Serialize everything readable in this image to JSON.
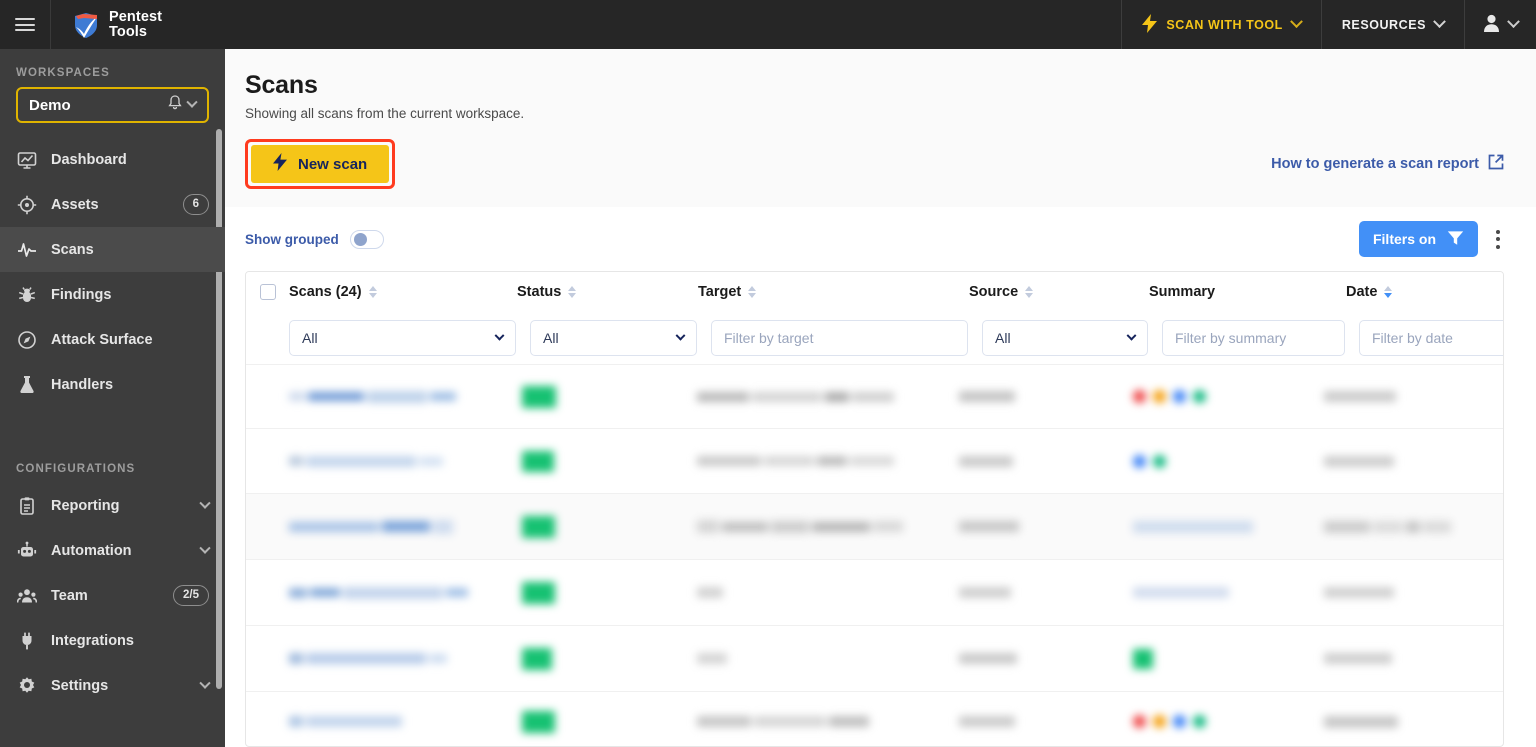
{
  "topbar": {
    "menu_icon": "hamburger-menu-icon",
    "logo": {
      "line1": "Pentest",
      "line2": "Tools",
      "icon": "shield-logo-icon"
    },
    "nav": [
      {
        "label": "SCAN WITH TOOL",
        "icon": "lightning-bolt-icon",
        "chevron": "chevron-down-icon",
        "color": "#F5C518"
      },
      {
        "label": "RESOURCES",
        "chevron": "chevron-down-icon",
        "color": "#f2f2f2"
      }
    ],
    "account": {
      "icon": "user-avatar-icon",
      "chevron": "chevron-down-icon"
    }
  },
  "sidebar": {
    "workspaces_label": "WORKSPACES",
    "workspace": {
      "name": "Demo",
      "bell_icon": "bell-icon",
      "chevron": "chevron-down-icon",
      "border_color": "#E0B400"
    },
    "items": [
      {
        "label": "Dashboard",
        "icon": "dashboard-icon",
        "active": false
      },
      {
        "label": "Assets",
        "icon": "target-icon",
        "badge": "6",
        "active": false
      },
      {
        "label": "Scans",
        "icon": "pulse-icon",
        "active": true
      },
      {
        "label": "Findings",
        "icon": "bug-icon",
        "active": false
      },
      {
        "label": "Attack Surface",
        "icon": "compass-icon",
        "active": false
      },
      {
        "label": "Handlers",
        "icon": "flask-icon",
        "active": false
      }
    ],
    "configurations_label": "CONFIGURATIONS",
    "config_items": [
      {
        "label": "Reporting",
        "icon": "clipboard-icon",
        "chevron": "chevron-down-icon"
      },
      {
        "label": "Automation",
        "icon": "robot-icon",
        "chevron": "chevron-down-icon"
      },
      {
        "label": "Team",
        "icon": "people-icon",
        "badge": "2/5"
      },
      {
        "label": "Integrations",
        "icon": "plug-icon"
      },
      {
        "label": "Settings",
        "icon": "gear-icon",
        "chevron": "chevron-down-icon"
      }
    ]
  },
  "main": {
    "title": "Scans",
    "subtitle": "Showing all scans from the current workspace.",
    "new_scan_button": {
      "label": "New scan",
      "icon": "lightning-bolt-icon",
      "bg": "#F5C518",
      "text_color": "#16245C",
      "highlight_color": "#FF3B1F"
    },
    "report_link": {
      "label": "How to generate a scan report",
      "icon": "external-link-icon",
      "color": "#3C5BA9"
    },
    "toolbar": {
      "show_grouped_label": "Show grouped",
      "show_grouped_on": false,
      "filters_button": {
        "label": "Filters on",
        "icon": "funnel-icon",
        "bg": "#4290F7"
      },
      "overflow_menu_icon": "kebab-menu-icon"
    },
    "table": {
      "columns": [
        {
          "key": "scans",
          "header": "Scans (24)",
          "sortable": true,
          "sort_active": false,
          "filter_type": "select",
          "filter_value": "All"
        },
        {
          "key": "status",
          "header": "Status",
          "sortable": true,
          "sort_active": false,
          "filter_type": "select",
          "filter_value": "All"
        },
        {
          "key": "target",
          "header": "Target",
          "sortable": true,
          "sort_active": false,
          "filter_type": "input",
          "filter_placeholder": "Filter by target"
        },
        {
          "key": "source",
          "header": "Source",
          "sortable": true,
          "sort_active": false,
          "filter_type": "select",
          "filter_value": "All"
        },
        {
          "key": "summary",
          "header": "Summary",
          "sortable": false,
          "filter_type": "input",
          "filter_placeholder": "Filter by summary"
        },
        {
          "key": "date",
          "header": "Date",
          "sortable": true,
          "sort_active": true,
          "filter_type": "input",
          "filter_placeholder": "Filter by date"
        }
      ],
      "select_all_checkbox": false,
      "rows_redacted": true,
      "row_count_visible": 6,
      "status_color": "#16C172",
      "severity_colors": [
        "#EF4444",
        "#F59E0B",
        "#3B82F6",
        "#10B981"
      ]
    }
  }
}
